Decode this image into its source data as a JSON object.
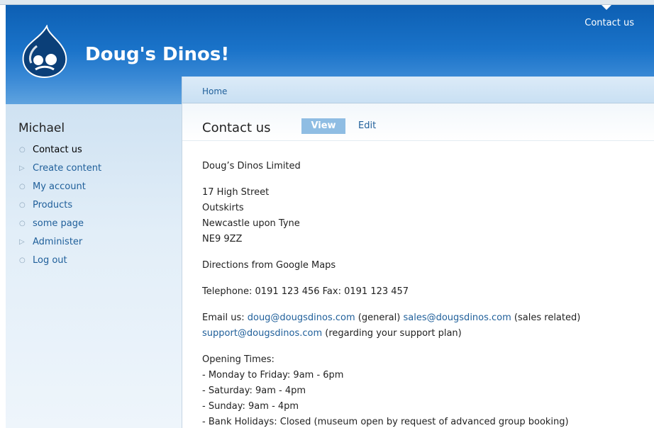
{
  "site": {
    "name": "Doug's Dinos!",
    "logo_icon": "drupal-drop-logo"
  },
  "header": {
    "primary_link": "Contact us"
  },
  "breadcrumb": {
    "home": "Home"
  },
  "sidebar": {
    "title": "Michael",
    "items": [
      {
        "label": "Contact us",
        "bullet": "circle-bullet-icon",
        "active": true
      },
      {
        "label": "Create content",
        "bullet": "triangle-bullet-icon",
        "active": false
      },
      {
        "label": "My account",
        "bullet": "circle-bullet-icon",
        "active": false
      },
      {
        "label": "Products",
        "bullet": "circle-bullet-icon",
        "active": false
      },
      {
        "label": "some page",
        "bullet": "circle-bullet-icon",
        "active": false
      },
      {
        "label": "Administer",
        "bullet": "triangle-bullet-icon",
        "active": false
      },
      {
        "label": "Log out",
        "bullet": "circle-bullet-icon",
        "active": false
      }
    ]
  },
  "page": {
    "title": "Contact us",
    "tabs": {
      "view": "View",
      "edit": "Edit"
    }
  },
  "content": {
    "company": "Doug’s Dinos Limited",
    "address": [
      "17 High Street",
      "Outskirts",
      "Newcastle upon Tyne",
      "NE9 9ZZ"
    ],
    "directions": "Directions from Google Maps",
    "phone": "Telephone: 0191 123 456 Fax: 0191 123 457",
    "email_prefix": "Email us: ",
    "email_general": "doug@dougsdinos.com",
    "email_general_note": " (general) ",
    "email_sales": "sales@dougsdinos.com",
    "email_sales_note": " (sales related)",
    "email_support": "support@dougsdinos.com",
    "email_support_note": " (regarding your support plan)",
    "opening_title": "Opening Times:",
    "opening": [
      "- Monday to Friday: 9am - 6pm",
      "- Saturday: 9am - 4pm",
      "- Sunday: 9am - 4pm",
      "- Bank Holidays: Closed (museum open by request of advanced group booking)"
    ]
  },
  "colors": {
    "header_blue": "#1a73c9",
    "link": "#1f5f9a",
    "tab_active": "#8fbde3",
    "sidebar_bg": "#e2eef8"
  }
}
